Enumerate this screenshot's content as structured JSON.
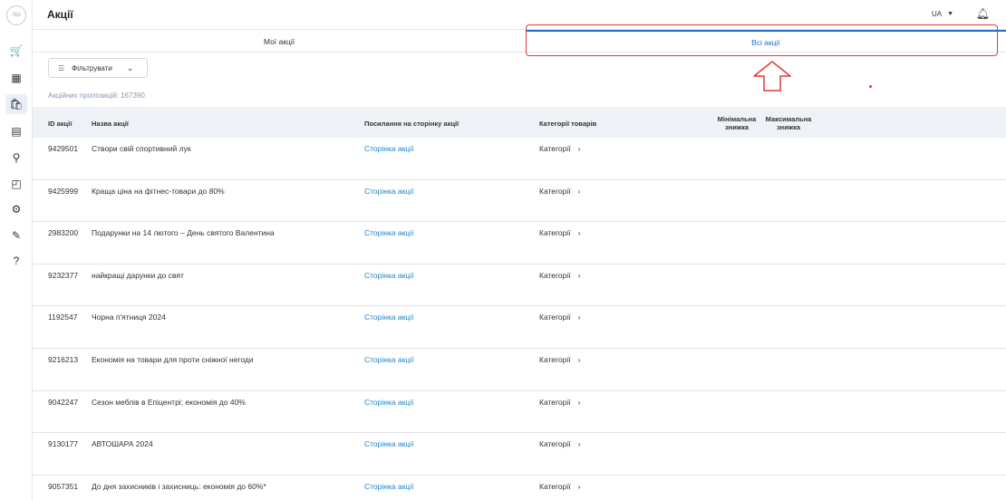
{
  "app": {
    "title": "Акції",
    "logo_text": "ЛШ"
  },
  "sidebar": {
    "items": [
      {
        "icon": "cart-icon",
        "glyph": "🛒"
      },
      {
        "icon": "storefront-icon",
        "glyph": "▦"
      },
      {
        "icon": "promo-bag-icon",
        "glyph": "🛍"
      },
      {
        "icon": "shop-icon",
        "glyph": "▤"
      },
      {
        "icon": "runner-icon",
        "glyph": "⚲"
      },
      {
        "icon": "wallet-icon",
        "glyph": "◰"
      },
      {
        "icon": "settings-icon",
        "glyph": "⚙"
      },
      {
        "icon": "handshake-icon",
        "glyph": "✎"
      },
      {
        "icon": "help-icon",
        "glyph": "?"
      }
    ]
  },
  "header": {
    "lang": "UA"
  },
  "tabs": {
    "my": "Мої акції",
    "all": "Всі акції"
  },
  "filter": {
    "label": "Фільтрувати"
  },
  "count_label": "Акційних пропозицій: 167390",
  "table": {
    "headers": {
      "id": "ID акції",
      "name": "Назва акції",
      "link": "Посилання на сторінку акції",
      "cat": "Категорії товарів",
      "min": "Мінімальна знижка",
      "max": "Максимальна знижка"
    },
    "rows": [
      {
        "id": "9429501",
        "name": "Створи свій спортивний лук",
        "link": "Сторінка акції",
        "cat": "Категорії"
      },
      {
        "id": "9425999",
        "name": "Краща ціна на фітнес-товари до 80%",
        "link": "Сторінка акції",
        "cat": "Категорії"
      },
      {
        "id": "2983200",
        "name": "Подарунки на 14 лютого – День святого Валентина",
        "link": "Сторінка акції",
        "cat": "Категорії"
      },
      {
        "id": "9232377",
        "name": "найкращі дарунки до свят",
        "link": "Сторінка акції",
        "cat": "Категорії"
      },
      {
        "id": "1192547",
        "name": "Чорна п'ятниця 2024",
        "link": "Сторінка акції",
        "cat": "Категорії"
      },
      {
        "id": "9216213",
        "name": "Економія на товари для проти сніжної негоди",
        "link": "Сторінка акції",
        "cat": "Категорії"
      },
      {
        "id": "9042247",
        "name": "Сезон меблів в Епіцентрі: економія до 40%",
        "link": "Сторінка акції",
        "cat": "Категорії"
      },
      {
        "id": "9130177",
        "name": "АВТОШАРА 2024",
        "link": "Сторінка акції",
        "cat": "Категорії"
      },
      {
        "id": "9057351",
        "name": "До дня захисників і захисниць: економія до 60%*",
        "link": "Сторінка акції",
        "cat": "Категорії"
      }
    ]
  }
}
